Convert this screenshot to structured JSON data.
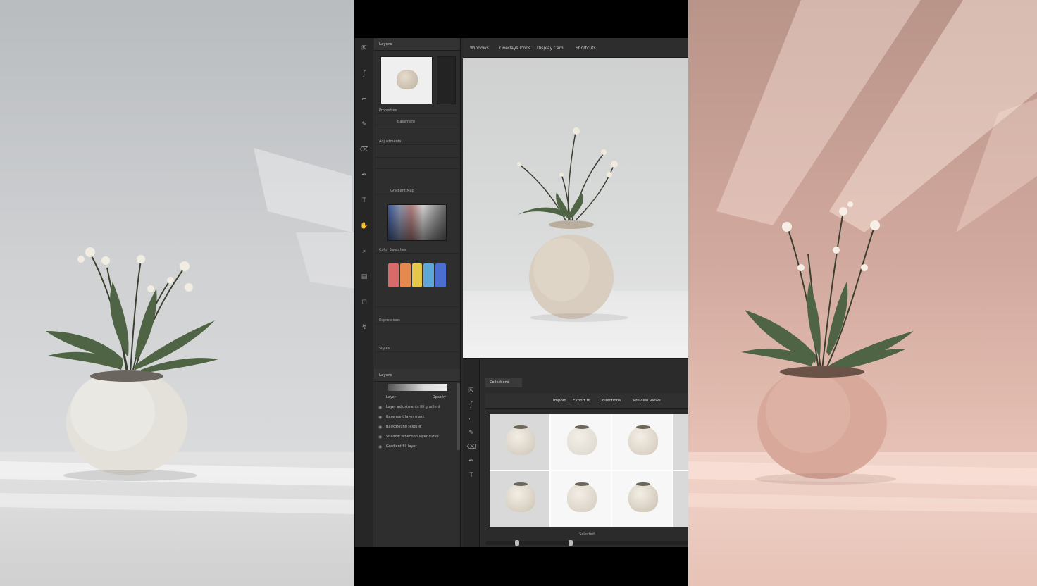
{
  "panel_header": "Layers",
  "tools": [
    {
      "icon": "move-icon",
      "glyph": "⇱"
    },
    {
      "icon": "lasso-icon",
      "glyph": "ʃ"
    },
    {
      "icon": "crop-icon",
      "glyph": "⌐"
    },
    {
      "icon": "brush-icon",
      "glyph": "✎"
    },
    {
      "icon": "eraser-icon",
      "glyph": "⌫"
    },
    {
      "icon": "pen-icon",
      "glyph": "✒"
    },
    {
      "icon": "type-icon",
      "glyph": "T"
    },
    {
      "icon": "hand-icon",
      "glyph": "✋"
    },
    {
      "icon": "zoom-icon",
      "glyph": "⌕"
    },
    {
      "icon": "gradient-icon",
      "glyph": "▤"
    },
    {
      "icon": "shape-icon",
      "glyph": "◻"
    },
    {
      "icon": "path-icon",
      "glyph": "↯"
    }
  ],
  "panels": {
    "properties_label": "Properties",
    "layer_name": "Basemant",
    "adjustments_label": "Adjustments",
    "channels_label": "Gradient Map",
    "colors_label": "Color Swatches",
    "history_label": "Expressions",
    "styles_label": "Styles",
    "layers_label": "Layers",
    "layer_list_header": [
      "Layer",
      "Opacity"
    ],
    "layer_rows": [
      "Layer adjustments fill gradient",
      "Basemant layer mask",
      "Background texture",
      "Shadow reflection layer curve",
      "Gradient fill layer"
    ]
  },
  "swatch_colors": [
    "#d96a6a",
    "#e58a4e",
    "#e5c84b",
    "#5da8d8",
    "#4a6fd0"
  ],
  "menu": [
    "Windows",
    "Overlays Icons",
    "Display Cam",
    "Shortcuts"
  ],
  "browser": {
    "tab_label": "Collections",
    "menu": [
      "Import",
      "Export fit",
      "Collections",
      "Preview views"
    ],
    "status": "Selected",
    "thumbs": [
      {
        "tone": "#cdc4b5"
      },
      {
        "tone": "#dad6ce"
      },
      {
        "tone": "#d2c8b9"
      },
      {
        "tone": "#d7d0c3"
      },
      {
        "tone": "#ccc2b1"
      },
      {
        "tone": "#d3cabd"
      },
      {
        "tone": "#c9bfae"
      },
      {
        "tone": "#d6cfc2"
      }
    ]
  }
}
